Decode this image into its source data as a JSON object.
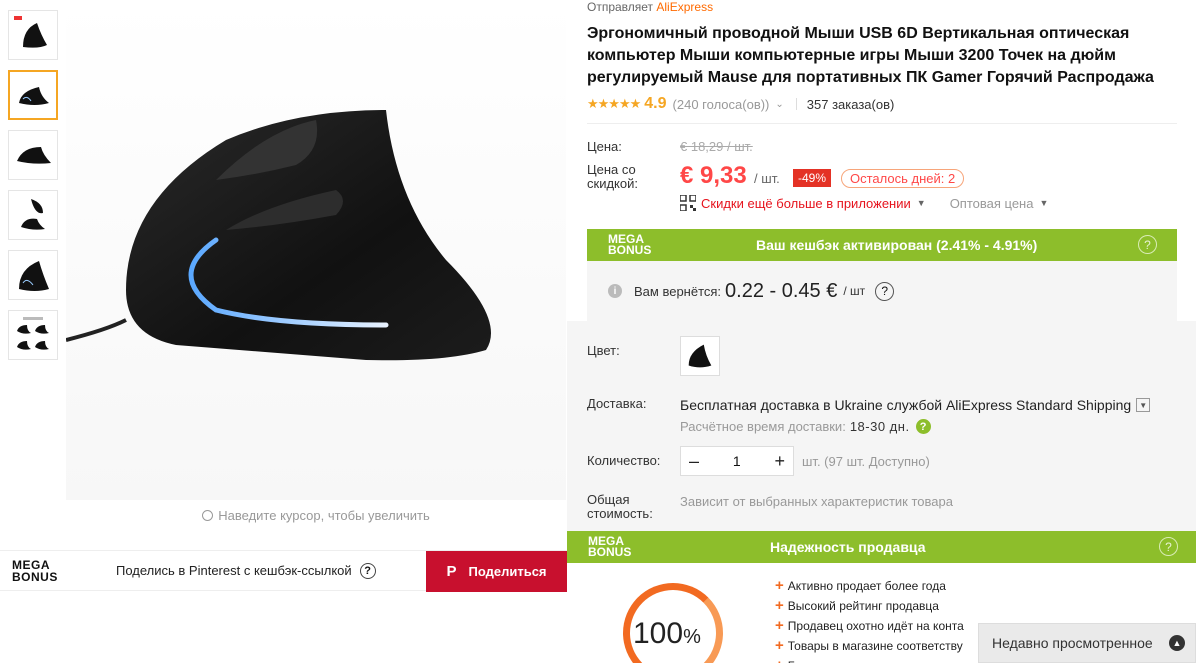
{
  "ships_by": {
    "label": "Отправляет",
    "brand": "AliExpress"
  },
  "title": "Эргономичный проводной Мыши USB 6D Вертикальная оптическая компьютер Мыши компьютерные игры Мыши 3200 Точек на дюйм регулируемый Mause для портативных ПК Gamer Горячий Распродажа",
  "rating": {
    "stars": "★★★★★",
    "score": "4.9",
    "votes": "(240 голоса(ов))",
    "orders": "357 заказа(ов)"
  },
  "price": {
    "label_price": "Цена:",
    "old": "€ 18,29 / шт.",
    "label_discount": "Цена со скидкой:",
    "current": "€ 9,33",
    "unit": "/ шт.",
    "discount": "-49%",
    "days_left": "Осталось дней: 2",
    "app_link": "Скидки ещё больше в приложении",
    "wholesale": "Оптовая цена"
  },
  "cashback": {
    "logo_line1": "MEGA",
    "logo_line2": "BONUS",
    "title": "Ваш кешбэк активирован (2.41% - 4.91%)",
    "return_label": "Вам вернётся:",
    "return_value": "0.22 - 0.45 €",
    "return_unit": "/ шт"
  },
  "options": {
    "color_label": "Цвет:",
    "delivery_label": "Доставка:",
    "delivery_text": "Бесплатная доставка в Ukraine службой AliExpress Standard Shipping",
    "delivery_time_label": "Расчётное время доставки:",
    "delivery_time": "18-30 дн.",
    "qty_label": "Количество:",
    "qty_value": "1",
    "qty_available": "шт. (97 шт. Доступно)",
    "total_label": "Общая стоимость:",
    "total_note": "Зависит от выбранных характеристик товара"
  },
  "reliability": {
    "title": "Надежность продавца",
    "percent": "100",
    "percent_sign": "%",
    "facts": [
      "Активно продает более года",
      "Высокий рейтинг продавца",
      "Продавец охотно идёт на конта",
      "Товары в магазине соответству",
      "Б"
    ]
  },
  "zoom_hint": "Наведите курсор, чтобы увеличить",
  "pinterest": {
    "text": "Поделись в Pinterest с кешбэк-ссылкой",
    "button": "Поделиться",
    "button_icon": "P"
  },
  "recently_viewed": "Недавно просмотренное",
  "colors": {
    "accent": "#ff4747",
    "green": "#8dbe2b",
    "orange": "#f26a21",
    "pinterest": "#c8102e"
  }
}
